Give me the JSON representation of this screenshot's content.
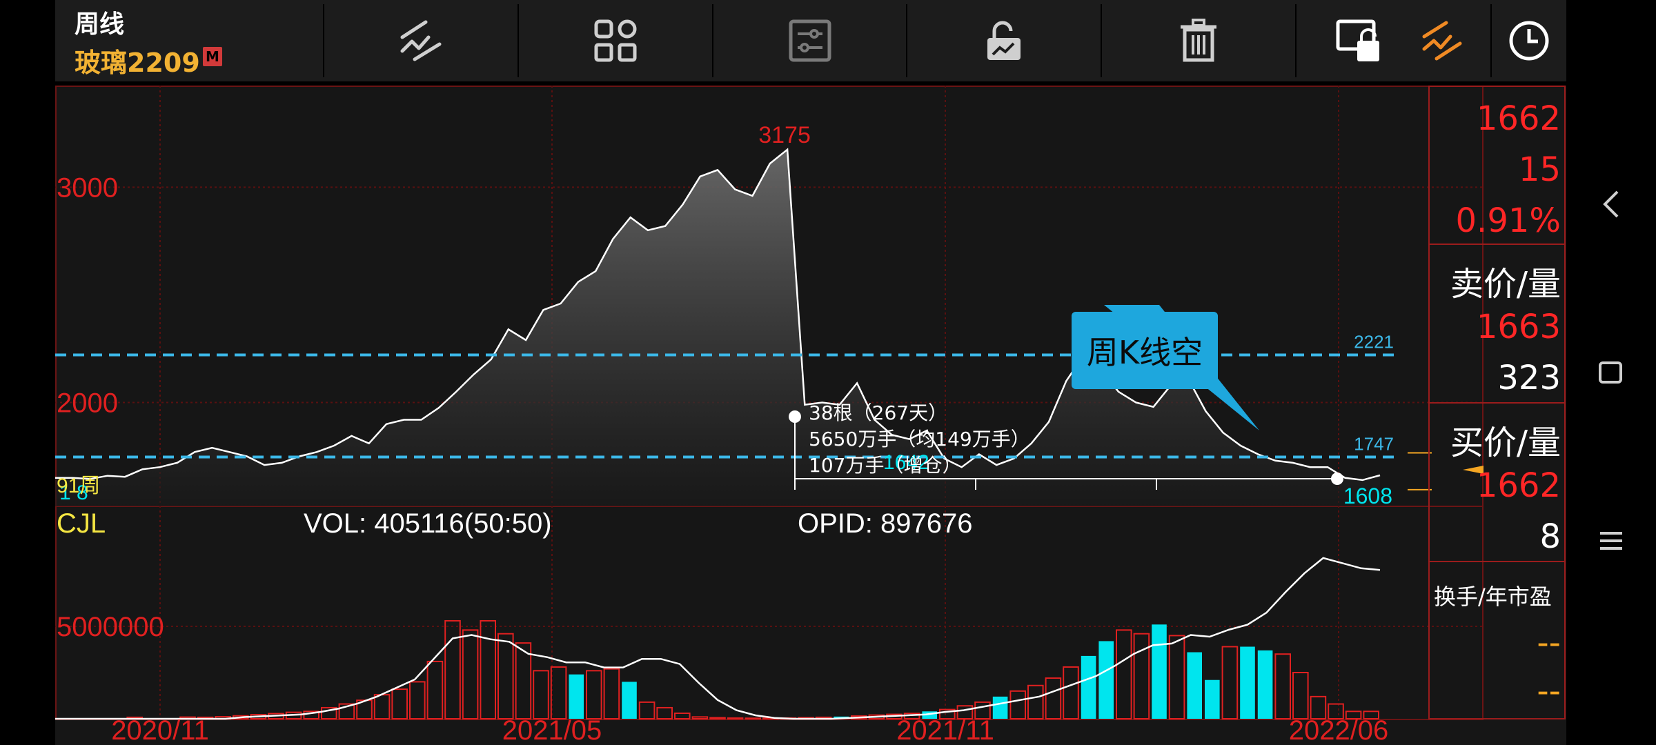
{
  "header": {
    "period": "周线",
    "contract": "玻璃2209",
    "badge": "M"
  },
  "toolbar": {
    "icons": [
      "draw-line-icon",
      "grid-layout-icon",
      "settings-sliders-icon",
      "unlock-icon",
      "trash-icon",
      "screen-lock-icon",
      "trend-line-icon",
      "clock-icon"
    ]
  },
  "sidebar": {
    "price": "1662",
    "change": "15",
    "change_pct": "0.91%",
    "ask_label": "卖价/量",
    "ask_price": "1663",
    "ask_vol": "323",
    "bid_label": "买价/量",
    "bid_price": "1662",
    "bid_vol": "8",
    "turnover_label": "换手/年市盈",
    "turnover_val": "--",
    "pe_val": "--"
  },
  "annotation": {
    "callout": "周K线空",
    "stat_line1": "38根（267天）",
    "stat_line2": "5650万手（均149万手）",
    "stat_line3": "107万手（增仓）",
    "overlap_text": "1642"
  },
  "indicator": {
    "name": "CJL",
    "vol_label": "VOL: 405116(50:50)",
    "opid_label": "OPID: 897676",
    "corner_label": "91周",
    "corner_label_b": "1 8"
  },
  "colors": {
    "up": "#e02020",
    "cyan": "#00e5ee",
    "dash": "#3cb8e8",
    "callout": "#1ea7dd",
    "grid": "#5a1010",
    "label_yellow": "#f5e642",
    "orange": "#f5a623"
  },
  "chart_data": [
    {
      "type": "area",
      "title": "",
      "y_ticks": [
        3000,
        2000
      ],
      "ylim": [
        1550,
        3280
      ],
      "x_tick_labels": [
        "2020/11",
        "2021/05",
        "2021/11",
        "2022/06"
      ],
      "peak_label": "3175",
      "low_label": "1608",
      "hlines": [
        {
          "value": 2221,
          "label": "2221"
        },
        {
          "value": 1747,
          "label": "1747"
        }
      ],
      "series": [
        {
          "values": [
            1650,
            1650,
            1645,
            1660,
            1655,
            1690,
            1700,
            1720,
            1770,
            1790,
            1770,
            1750,
            1710,
            1720,
            1750,
            1770,
            1800,
            1845,
            1810,
            1900,
            1920,
            1920,
            1975,
            2050,
            2130,
            2200,
            2340,
            2290,
            2430,
            2460,
            2560,
            2610,
            2760,
            2860,
            2800,
            2820,
            2920,
            3050,
            3080,
            2990,
            2960,
            3110,
            3175,
            1990,
            2000,
            1990,
            2090,
            1920,
            1850,
            1830,
            1870,
            1740,
            1700,
            1760,
            1710,
            1740,
            1810,
            1910,
            2100,
            2220,
            2150,
            2050,
            2000,
            1980,
            2080,
            2110,
            1960,
            1860,
            1800,
            1760,
            1730,
            1720,
            1700,
            1700,
            1650,
            1640,
            1662
          ]
        }
      ]
    },
    {
      "type": "bar",
      "title": "",
      "y_ticks": [
        5000000
      ],
      "ylim": [
        0,
        10000000
      ],
      "bar_up": [
        0,
        0,
        0,
        0,
        80000,
        0,
        0,
        90000,
        80000,
        110000,
        160000,
        220000,
        280000,
        350000,
        400000,
        600000,
        800000,
        1000000,
        1300000,
        1600000,
        2000000,
        3100000,
        5300000,
        4800000,
        5300000,
        4600000,
        4100000,
        2600000,
        2800000,
        2400000,
        2600000,
        2700000,
        2000000,
        900000,
        600000,
        300000,
        100000,
        60000,
        40000,
        30000,
        30000,
        40000,
        60000,
        80000,
        120000,
        150000,
        200000,
        240000,
        290000,
        400000,
        500000,
        700000,
        900000,
        1200000,
        1500000,
        1800000,
        2200000,
        2800000,
        3400000,
        4200000,
        4800000,
        4600000,
        5100000,
        4500000,
        3600000,
        2100000,
        3900000,
        3900000,
        3700000,
        3500000,
        2500000,
        1200000,
        800000,
        400000,
        400000
      ],
      "bar_cyan_positions": [
        29,
        32,
        44,
        49,
        53,
        58,
        59,
        62,
        64,
        65,
        67,
        68
      ],
      "bar_up_positions": [
        20,
        21,
        22,
        23,
        24,
        25,
        26,
        27,
        28,
        30,
        31,
        33,
        35,
        36,
        37,
        38,
        39,
        40,
        41,
        42,
        43,
        45,
        46,
        47,
        48,
        50,
        51,
        52,
        54,
        55,
        56,
        57,
        60,
        61,
        63,
        66,
        69
      ]
    }
  ]
}
